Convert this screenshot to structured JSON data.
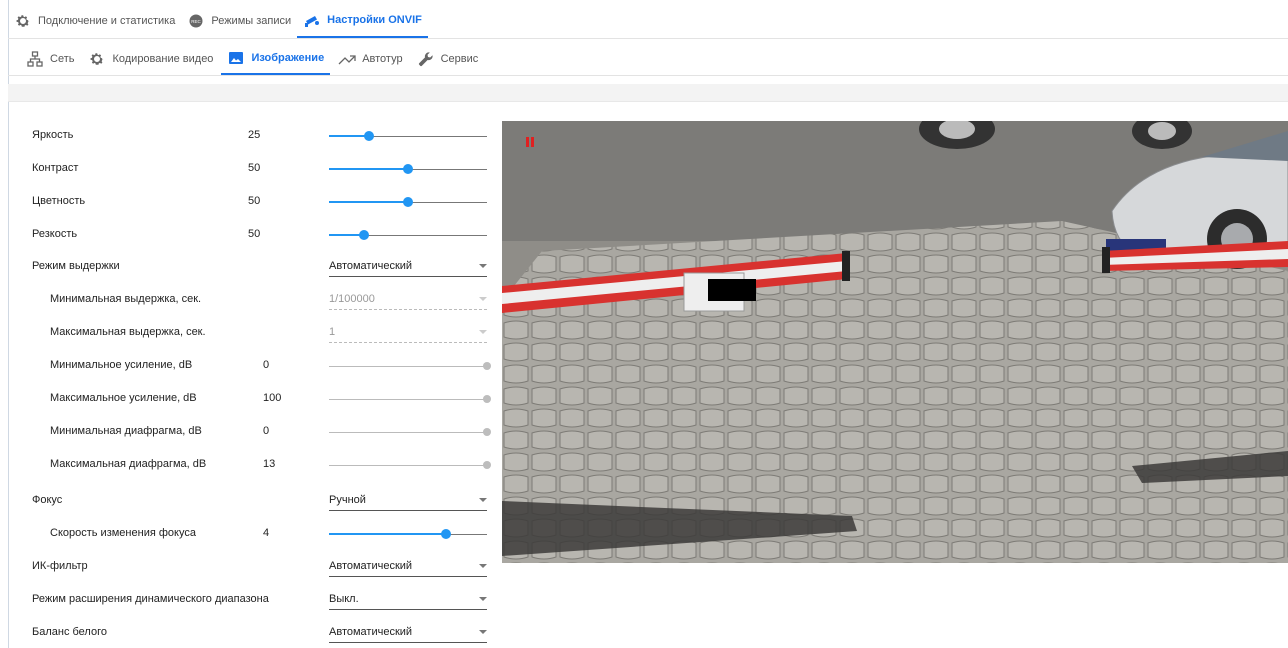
{
  "top_tabs": [
    {
      "label": "Подключение и статистика",
      "icon": "gear-icon"
    },
    {
      "label": "Режимы записи",
      "icon": "rec-icon"
    },
    {
      "label": "Настройки ONVIF",
      "icon": "camera-icon"
    }
  ],
  "sub_tabs": [
    {
      "label": "Сеть",
      "icon": "network-icon"
    },
    {
      "label": "Кодирование видео",
      "icon": "gear-icon"
    },
    {
      "label": "Изображение",
      "icon": "image-icon"
    },
    {
      "label": "Автотур",
      "icon": "tour-icon"
    },
    {
      "label": "Сервис",
      "icon": "wrench-icon"
    }
  ],
  "active_top_tab": "Настройки ONVIF",
  "active_sub_tab": "Изображение",
  "settings": {
    "brightness": {
      "label": "Яркость",
      "value": "25",
      "fraction": 0.25
    },
    "contrast": {
      "label": "Контраст",
      "value": "50",
      "fraction": 0.5
    },
    "saturation": {
      "label": "Цветность",
      "value": "50",
      "fraction": 0.5
    },
    "sharpness": {
      "label": "Резкость",
      "value": "50",
      "fraction": 0.22
    },
    "exposure_mode": {
      "label": "Режим выдержки",
      "selected": "Автоматический"
    },
    "min_exposure": {
      "label": "Минимальная выдержка, сек.",
      "selected": "1/100000"
    },
    "max_exposure": {
      "label": "Максимальная выдержка, сек.",
      "selected": "1"
    },
    "min_gain": {
      "label": "Минимальное усиление, dB",
      "value": "0"
    },
    "max_gain": {
      "label": "Максимальное усиление, dB",
      "value": "100"
    },
    "min_iris": {
      "label": "Минимальная диафрагма, dB",
      "value": "0"
    },
    "max_iris": {
      "label": "Максимальная диафрагма, dB",
      "value": "13"
    },
    "focus": {
      "label": "Фокус",
      "selected": "Ручной"
    },
    "focus_speed": {
      "label": "Скорость изменения фокуса",
      "value": "4",
      "fraction": 0.74
    },
    "ir_filter": {
      "label": "ИК-фильтр",
      "selected": "Автоматический"
    },
    "wdr": {
      "label": "Режим расширения динамического диапазона",
      "selected": "Выкл."
    },
    "white_balance": {
      "label": "Баланс белого",
      "selected": "Автоматический"
    }
  },
  "colors": {
    "accent": "#1a73e8",
    "slider": "#2196f3",
    "pause": "#e02020"
  }
}
